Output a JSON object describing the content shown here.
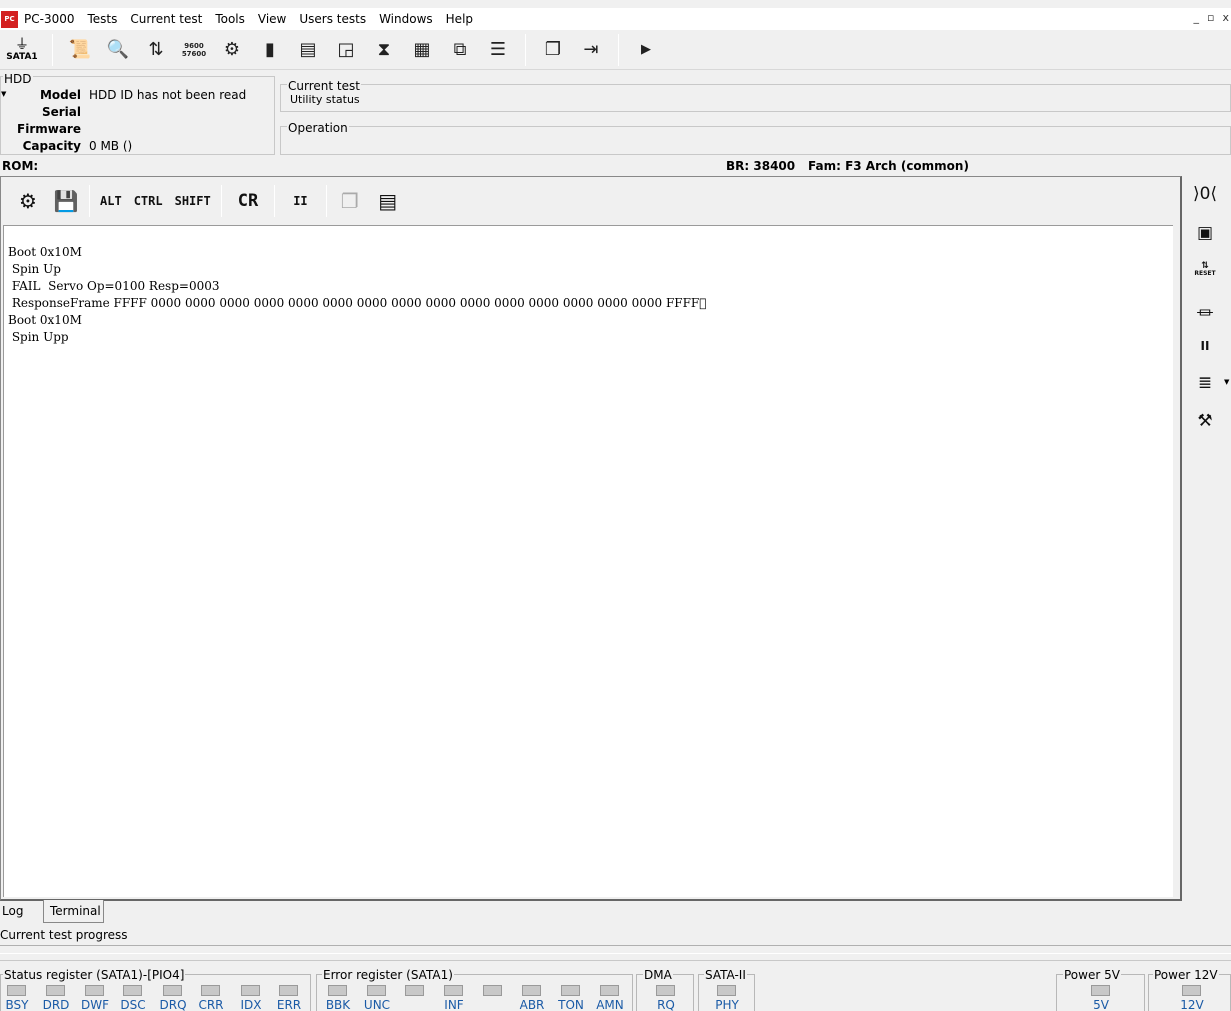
{
  "menu": {
    "app_name": "PC-3000",
    "items": [
      "Tests",
      "Current test",
      "Tools",
      "View",
      "Users tests",
      "Windows",
      "Help"
    ],
    "window_controls": [
      "_",
      "▫",
      "x"
    ]
  },
  "toolbar": {
    "sata_port_label": "SATA1",
    "speed_top": "9600",
    "speed_bottom": "57600"
  },
  "hdd": {
    "legend": "HDD",
    "model_label": "Model",
    "model_value": "HDD ID has not been read",
    "serial_label": "Serial",
    "serial_value": "",
    "firmware_label": "Firmware",
    "firmware_value": "",
    "capacity_label": "Capacity",
    "capacity_value": "0 MB ()"
  },
  "current_test": {
    "legend": "Current test",
    "status": "Utility status"
  },
  "operation": {
    "legend": "Operation"
  },
  "rom_line": {
    "rom": "ROM:",
    "br": "BR: 38400",
    "fam": "Fam: F3 Arch (common)"
  },
  "terminal_toolbar": {
    "alt": "ALT",
    "ctrl": "CTRL",
    "shift": "SHIFT",
    "cr": "CR",
    "pause": "II"
  },
  "terminal_lines": [
    "Boot 0x10M",
    " Spin Up",
    " FAIL  Servo Op=0100 Resp=0003",
    " ResponseFrame FFFF 0000 0000 0000 0000 0000 0000 0000 0000 0000 0000 0000 0000 0000 0000 0000 FFFF\u0000",
    "Boot 0x10M",
    " Spin Upp"
  ],
  "right_toolbar": {
    "reset_label": "RESET",
    "pause": "II"
  },
  "tabs": [
    {
      "label": "Log",
      "active": false
    },
    {
      "label": "Terminal",
      "active": true
    }
  ],
  "progress": {
    "label": "Current test progress"
  },
  "registers": {
    "status": {
      "legend": "Status register (SATA1)-[PIO4]",
      "bits": [
        "BSY",
        "DRD",
        "DWF",
        "DSC",
        "DRQ",
        "CRR",
        "IDX",
        "ERR"
      ]
    },
    "error": {
      "legend": "Error register (SATA1)",
      "bits": [
        "BBK",
        "UNC",
        "",
        "INF",
        "",
        "ABR",
        "TON",
        "AMN"
      ]
    },
    "dma": {
      "legend": "DMA",
      "bits": [
        "RQ"
      ]
    },
    "sata2": {
      "legend": "SATA-II",
      "bits": [
        "PHY"
      ]
    },
    "power5": {
      "legend": "Power 5V",
      "bits": [
        "5V"
      ]
    },
    "power12": {
      "legend": "Power 12V",
      "bits": [
        "12V"
      ]
    }
  },
  "colors": {
    "led_off": "#c8c8c8",
    "led_label": "#1a5aa6",
    "app_logo": "#d32020"
  }
}
